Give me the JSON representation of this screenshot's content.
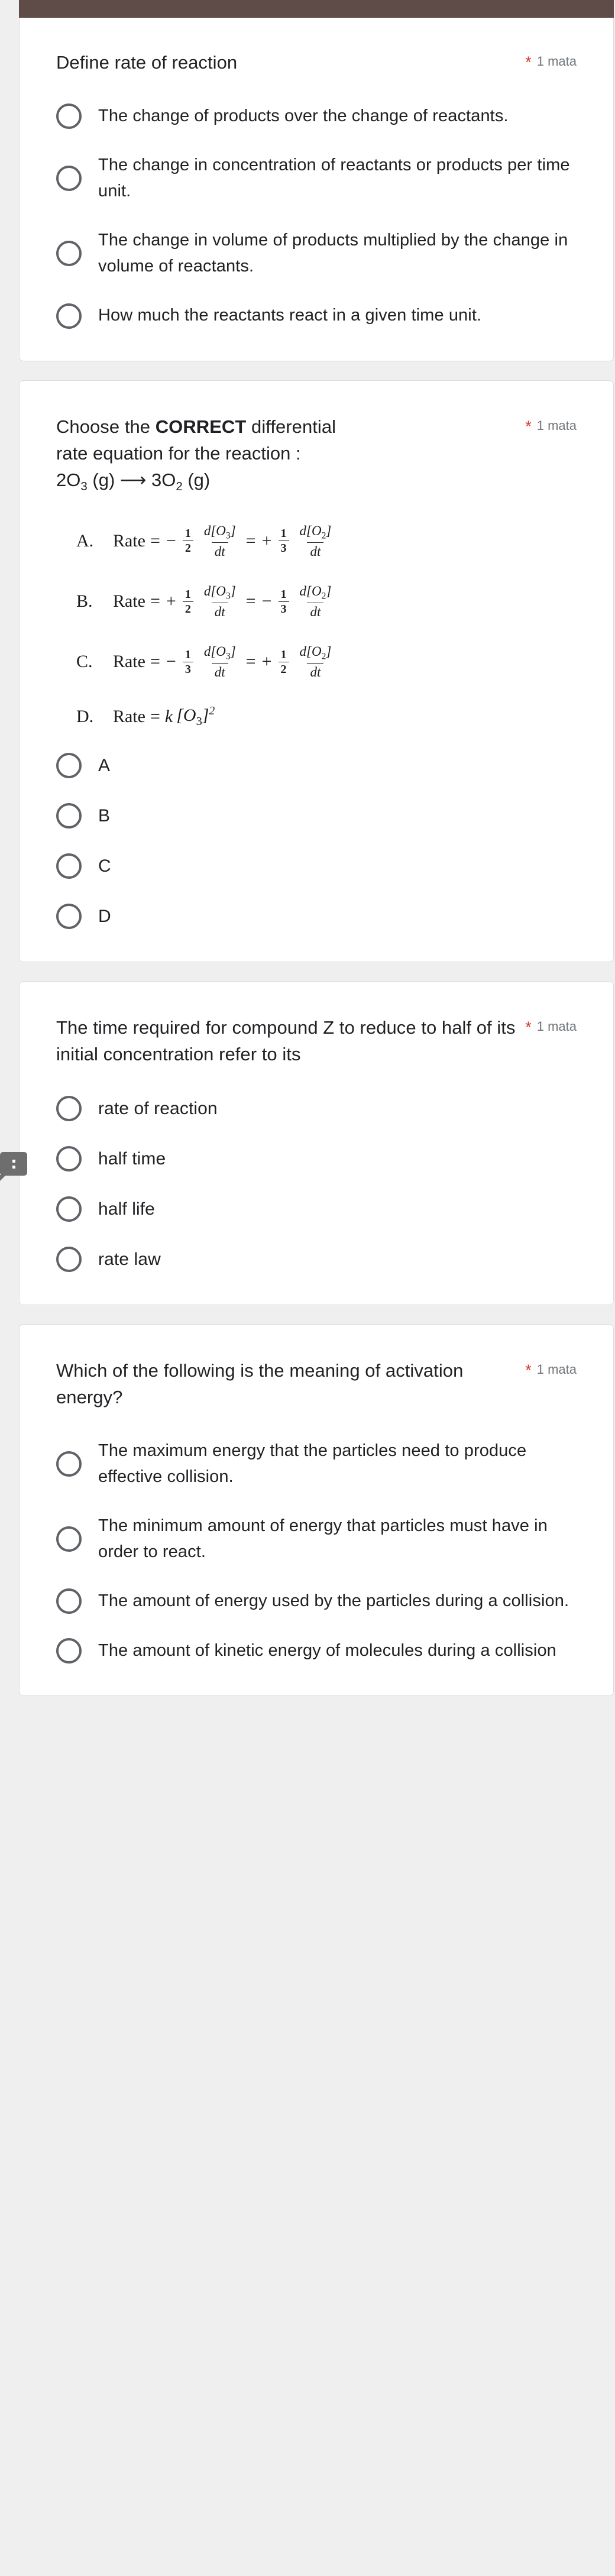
{
  "colors": {
    "header_bar": "#5f4c48",
    "page_background": "#efefef",
    "card_background": "#ffffff",
    "card_border": "#dadce0",
    "required_star": "#d93025",
    "points_text": "#70757a",
    "radio_outline": "#5f6368",
    "badge_background": "#6e6e6e",
    "primary_text": "#202124"
  },
  "required_marker": "*",
  "points_label": "1 mata",
  "side_badge": {
    "icon": "kebab-menu-icon",
    "glyph": "⋮"
  },
  "questions": [
    {
      "id": "q1",
      "title": "Define rate of reaction",
      "required": "*",
      "points": "1 mata",
      "options": [
        "The change of products over the change of reactants.",
        "The change in concentration of reactants or products per time unit.",
        "The change in volume of products multiplied by the change in volume of reactants.",
        "How much the reactants react in a given time unit."
      ]
    },
    {
      "id": "q2",
      "title_prefix": "Choose the ",
      "title_bold": "CORRECT",
      "title_suffix": " differential",
      "title_line2": "rate equation for the reaction :",
      "reaction": {
        "left_coeff": "2",
        "left_species": "O",
        "left_sub": "3",
        "left_state": "(g)",
        "arrow": "⟶",
        "right_coeff": "3",
        "right_species": "O",
        "right_sub": "2",
        "right_state": "(g)"
      },
      "required": "*",
      "points": "1 mata",
      "equations": [
        {
          "label": "A.",
          "lhs": "Rate",
          "eq": "=",
          "term1_sign": "−",
          "term1_frac_num": "1",
          "term1_frac_den": "2",
          "term1_d_num": "d[O",
          "term1_d_sub": "3",
          "term1_d_num_end": "]",
          "term1_d_den": "dt",
          "mid_eq": "=",
          "term2_sign": "+",
          "term2_frac_num": "1",
          "term2_frac_den": "3",
          "term2_d_num": "d[O",
          "term2_d_sub": "2",
          "term2_d_num_end": "]",
          "term2_d_den": "dt"
        },
        {
          "label": "B.",
          "lhs": "Rate",
          "eq": "=",
          "term1_sign": "+",
          "term1_frac_num": "1",
          "term1_frac_den": "2",
          "term1_d_num": "d[O",
          "term1_d_sub": "3",
          "term1_d_num_end": "]",
          "term1_d_den": "dt",
          "mid_eq": "=",
          "term2_sign": "−",
          "term2_frac_num": "1",
          "term2_frac_den": "3",
          "term2_d_num": "d[O",
          "term2_d_sub": "2",
          "term2_d_num_end": "]",
          "term2_d_den": "dt"
        },
        {
          "label": "C.",
          "lhs": "Rate",
          "eq": "=",
          "term1_sign": "−",
          "term1_frac_num": "1",
          "term1_frac_den": "3",
          "term1_d_num": "d[O",
          "term1_d_sub": "3",
          "term1_d_num_end": "]",
          "term1_d_den": "dt",
          "mid_eq": "=",
          "term2_sign": "+",
          "term2_frac_num": "1",
          "term2_frac_den": "2",
          "term2_d_num": "d[O",
          "term2_d_sub": "2",
          "term2_d_num_end": "]",
          "term2_d_den": "dt"
        }
      ],
      "equation_d": {
        "label": "D.",
        "lhs": "Rate",
        "eq": "=",
        "k": "k",
        "bracket_open": "[O",
        "sub": "3",
        "bracket_close": "]",
        "power": "2"
      },
      "options": [
        "A",
        "B",
        "C",
        "D"
      ]
    },
    {
      "id": "q3",
      "title": "The time required for compound Z to reduce to half of its initial concentration refer to its",
      "required": "*",
      "points": "1 mata",
      "options": [
        "rate of reaction",
        "half time",
        "half life",
        "rate law"
      ]
    },
    {
      "id": "q4",
      "title": "Which of the following is the meaning of activation energy?",
      "required": "*",
      "points": "1 mata",
      "options": [
        "The maximum energy that the particles need to produce effective collision.",
        "The minimum amount of energy that particles must have in order to react.",
        "The amount of energy used by the particles during a collision.",
        "The amount of kinetic energy of molecules during a collision"
      ]
    }
  ]
}
